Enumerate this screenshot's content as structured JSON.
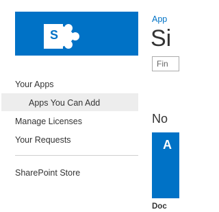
{
  "header": {
    "logo_letter": "S",
    "breadcrumb": "App",
    "title": "Si",
    "brand_color": "#0072c6"
  },
  "nav": {
    "your_apps": "Your Apps",
    "apps_you_can_add": "Apps You Can Add",
    "manage_licenses": "Manage Licenses",
    "your_requests": "Your Requests",
    "sharepoint_store": "SharePoint Store"
  },
  "search": {
    "placeholder": "Fin"
  },
  "section": {
    "heading": "No"
  },
  "app_tile": {
    "glyph": "A",
    "name": "Doc"
  }
}
